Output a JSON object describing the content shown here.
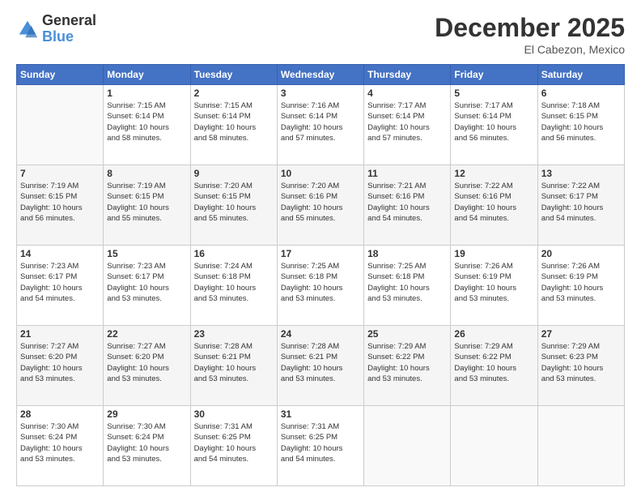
{
  "logo": {
    "general": "General",
    "blue": "Blue"
  },
  "title": "December 2025",
  "location": "El Cabezon, Mexico",
  "days_header": [
    "Sunday",
    "Monday",
    "Tuesday",
    "Wednesday",
    "Thursday",
    "Friday",
    "Saturday"
  ],
  "weeks": [
    [
      {
        "day": "",
        "info": ""
      },
      {
        "day": "1",
        "info": "Sunrise: 7:15 AM\nSunset: 6:14 PM\nDaylight: 10 hours\nand 58 minutes."
      },
      {
        "day": "2",
        "info": "Sunrise: 7:15 AM\nSunset: 6:14 PM\nDaylight: 10 hours\nand 58 minutes."
      },
      {
        "day": "3",
        "info": "Sunrise: 7:16 AM\nSunset: 6:14 PM\nDaylight: 10 hours\nand 57 minutes."
      },
      {
        "day": "4",
        "info": "Sunrise: 7:17 AM\nSunset: 6:14 PM\nDaylight: 10 hours\nand 57 minutes."
      },
      {
        "day": "5",
        "info": "Sunrise: 7:17 AM\nSunset: 6:14 PM\nDaylight: 10 hours\nand 56 minutes."
      },
      {
        "day": "6",
        "info": "Sunrise: 7:18 AM\nSunset: 6:15 PM\nDaylight: 10 hours\nand 56 minutes."
      }
    ],
    [
      {
        "day": "7",
        "info": "Sunrise: 7:19 AM\nSunset: 6:15 PM\nDaylight: 10 hours\nand 56 minutes."
      },
      {
        "day": "8",
        "info": "Sunrise: 7:19 AM\nSunset: 6:15 PM\nDaylight: 10 hours\nand 55 minutes."
      },
      {
        "day": "9",
        "info": "Sunrise: 7:20 AM\nSunset: 6:15 PM\nDaylight: 10 hours\nand 55 minutes."
      },
      {
        "day": "10",
        "info": "Sunrise: 7:20 AM\nSunset: 6:16 PM\nDaylight: 10 hours\nand 55 minutes."
      },
      {
        "day": "11",
        "info": "Sunrise: 7:21 AM\nSunset: 6:16 PM\nDaylight: 10 hours\nand 54 minutes."
      },
      {
        "day": "12",
        "info": "Sunrise: 7:22 AM\nSunset: 6:16 PM\nDaylight: 10 hours\nand 54 minutes."
      },
      {
        "day": "13",
        "info": "Sunrise: 7:22 AM\nSunset: 6:17 PM\nDaylight: 10 hours\nand 54 minutes."
      }
    ],
    [
      {
        "day": "14",
        "info": "Sunrise: 7:23 AM\nSunset: 6:17 PM\nDaylight: 10 hours\nand 54 minutes."
      },
      {
        "day": "15",
        "info": "Sunrise: 7:23 AM\nSunset: 6:17 PM\nDaylight: 10 hours\nand 53 minutes."
      },
      {
        "day": "16",
        "info": "Sunrise: 7:24 AM\nSunset: 6:18 PM\nDaylight: 10 hours\nand 53 minutes."
      },
      {
        "day": "17",
        "info": "Sunrise: 7:25 AM\nSunset: 6:18 PM\nDaylight: 10 hours\nand 53 minutes."
      },
      {
        "day": "18",
        "info": "Sunrise: 7:25 AM\nSunset: 6:18 PM\nDaylight: 10 hours\nand 53 minutes."
      },
      {
        "day": "19",
        "info": "Sunrise: 7:26 AM\nSunset: 6:19 PM\nDaylight: 10 hours\nand 53 minutes."
      },
      {
        "day": "20",
        "info": "Sunrise: 7:26 AM\nSunset: 6:19 PM\nDaylight: 10 hours\nand 53 minutes."
      }
    ],
    [
      {
        "day": "21",
        "info": "Sunrise: 7:27 AM\nSunset: 6:20 PM\nDaylight: 10 hours\nand 53 minutes."
      },
      {
        "day": "22",
        "info": "Sunrise: 7:27 AM\nSunset: 6:20 PM\nDaylight: 10 hours\nand 53 minutes."
      },
      {
        "day": "23",
        "info": "Sunrise: 7:28 AM\nSunset: 6:21 PM\nDaylight: 10 hours\nand 53 minutes."
      },
      {
        "day": "24",
        "info": "Sunrise: 7:28 AM\nSunset: 6:21 PM\nDaylight: 10 hours\nand 53 minutes."
      },
      {
        "day": "25",
        "info": "Sunrise: 7:29 AM\nSunset: 6:22 PM\nDaylight: 10 hours\nand 53 minutes."
      },
      {
        "day": "26",
        "info": "Sunrise: 7:29 AM\nSunset: 6:22 PM\nDaylight: 10 hours\nand 53 minutes."
      },
      {
        "day": "27",
        "info": "Sunrise: 7:29 AM\nSunset: 6:23 PM\nDaylight: 10 hours\nand 53 minutes."
      }
    ],
    [
      {
        "day": "28",
        "info": "Sunrise: 7:30 AM\nSunset: 6:24 PM\nDaylight: 10 hours\nand 53 minutes."
      },
      {
        "day": "29",
        "info": "Sunrise: 7:30 AM\nSunset: 6:24 PM\nDaylight: 10 hours\nand 53 minutes."
      },
      {
        "day": "30",
        "info": "Sunrise: 7:31 AM\nSunset: 6:25 PM\nDaylight: 10 hours\nand 54 minutes."
      },
      {
        "day": "31",
        "info": "Sunrise: 7:31 AM\nSunset: 6:25 PM\nDaylight: 10 hours\nand 54 minutes."
      },
      {
        "day": "",
        "info": ""
      },
      {
        "day": "",
        "info": ""
      },
      {
        "day": "",
        "info": ""
      }
    ]
  ]
}
